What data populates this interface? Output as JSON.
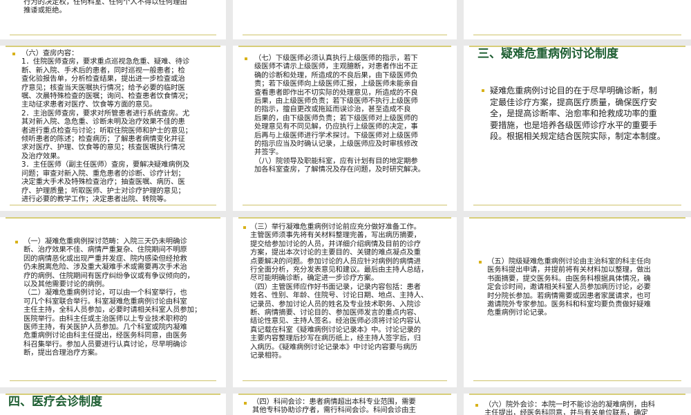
{
  "slides": {
    "top_left": {
      "text": "行为的决定权，任何科室、任何个人不得以任何理由\n推诿或拒绝。"
    },
    "top_right": {
      "text": ""
    },
    "mid_left": {
      "text": "（六）查房内容：\n1．住院医师查房，要求重点巡视急危重、疑难、待诊\n断、新入院、手术后的患者，同时巡视一般患者；检\n查化验报告单，分析检查结果，提出进一步检查或治\n疗意见；核查当天医嘱执行情况；给予必要的临时医\n嘱、次晨特殊检查的医嘱；询问、检查患者饮食情况；\n主动征求患者对医疗、饮食等方面的意见。\n2．主治医师查房，要求对所管患者进行系统查房。尤\n其对新入院、急危重、诊断未明及治疗效果不佳的患\n者进行重点检查与讨论；听取住院医师和护士的意见；\n倾听患者的陈述；检查病历；了解患者病情变化并征\n求对医疗、护理、饮食等的意见；核查医嘱执行情况\n及治疗效果。\n3．主任医师（副主任医师）查房，要解决疑难病例及\n问题；审查对新入院、重危患者的诊断、诊疗计划；\n决定重大手术及特殊检查治疗；抽查医嘱、病历、医\n疗、护理质量；听取医师、护士对诊疗护理的意见；\n进行必要的教学工作；决定患者出院、转院等。"
    },
    "mid_center": {
      "text": "（七）下级医师必须认真执行上级医师的指示，若下\n级医师不请示上级医师，主观臆断，对患者作出不正\n确的诊断和处理，所造成的不良后果，由下级医师负\n责；若下级医师向上级医师汇报，上级医师未能亲自\n查看患者即作出不切实际的处理意见，所造成的不良\n后果，由上级医师负责；若下级医师不执行上级医师\n的指示，擅自更改或拖延而误诊治，甚至造成不良\n后果的，由下级医师负责；若下级医师对上级医师的\n处理意见有不同见解，仍应执行上级医师的决定，事\n后再与上级医师进行学术探讨。下级医师对上级医师\n的指示应当及时确认记录，上级医师应及时审核修改\n并签字。\n（八）院领导及职能科室，应有计划有目的地定期参\n加各科室查房，了解情况及存在问题，及时研究解决。"
    },
    "mid_right": {
      "heading": "三、疑难危重病例讨论制度",
      "text": "疑难危重病例讨论目的在于尽早明确诊断，制\n定最佳诊疗方案，提高医疗质量，确保医疗安\n全，是提高诊断率、治愈率和抢救成功率的重\n要措施，也是培养各级医师诊疗水平的重要手\n段。根据相关规定结合医院实际，制定本制度。"
    },
    "low_left": {
      "text": "（一）凝难危重病例探讨范畴：入院三天仍未明确诊\n断、治疗效果不佳、病情严重复杂、住院期间不明原\n因的病情恶化或出现严重并发症、院内感染但经抢救\n仍未脱离危险、涉及重大凝难手术或需要再次手术治\n疗的病例、住院期间有医疗纠纷争议或有争议倾向的，\n以及其他需要讨论的病例。\n（二）凝难危重病例讨论，可以由一个科室举行，也\n可几个科室联合举行。科室凝难危重病例讨论由科室\n主任主持，全科人员参加，必要时请相关科室人员参加；\n医院举行。由科主任或主治医师以上专业技术职称的\n医师主持，有关医护人员参加。几个科室或院内凝难\n危重病例讨论由科主任提出，经医务科同意，由医务\n科召集举行。参加人员要进行认真讨论，尽早明确诊\n断，提出合理治疗方案。"
    },
    "low_center": {
      "text": "（三）举行凝难危重病例讨论前应充分做好准备工作。\n主管医师须事先将有关材料整理完善，写出病历摘要，\n提交给参加讨论的人员，并详细介绍病情及目前的诊疗\n方案，提出本次讨论的主要目的、关键的难点凝点及重\n点要解决的问题。参加讨论的人员应针对病例的病情进\n行全面分析，充分发表意见和建议。最后由主持人总结，\n尽可能明确诊断，确定进一步诊疗方案。\n（四）主管医师应作好书面记录，记录内容包括：患者\n姓名、性别、年龄、住院号、讨论日期、地点、主持人、\n记录员、参加讨论人员的姓名及专业技术职务、入院诊\n断、病情摘要、讨论目的、参加医师发言的重点内容、\n结论性意见、主持人签名。经治医师必须将讨论内容认\n真记载在科室《疑难病例讨论记录本》中。讨论记录的\n主要内容整理后抄写在病历纸上，经主持人签字后，归\n入病历。《疑难病例讨论记录本》中讨论内容要与病历\n记录相符。"
    },
    "low_right": {
      "text": "（五）院级疑难危重病例讨论由主治科室的科主任向\n医务科提出申请，并提前将有关材料加以整理，做出\n书面摘要，提交医务科。由医务科根据具体情况，确\n定会诊时间，邀请相关科室人员参加病历讨论，必要\n时分院长参加。若病情需要或因患者家属请求，也可\n邀请院外专家参加。医务科和科室均要负责做好疑难\n危重病例讨论记录。"
    },
    "bottom_left": {
      "heading": "四、医疗会诊制度"
    },
    "bottom_center": {
      "text": "（四）科间会诊：患者病情超出本科专业范围，需要\n其他专科协助诊疗者，需行科间会诊。科间会诊由主"
    },
    "bottom_right": {
      "text": "（六）院外会诊：本院一时不能诊治的凝难病例，由科\n主任提出，经医务科同意，并与有关单位联系，确定"
    }
  },
  "colors": {
    "gap": "#e9e9e9",
    "rule": "#cfc36a",
    "bullet": "#d8b21a",
    "heading": "#1f5f33"
  }
}
